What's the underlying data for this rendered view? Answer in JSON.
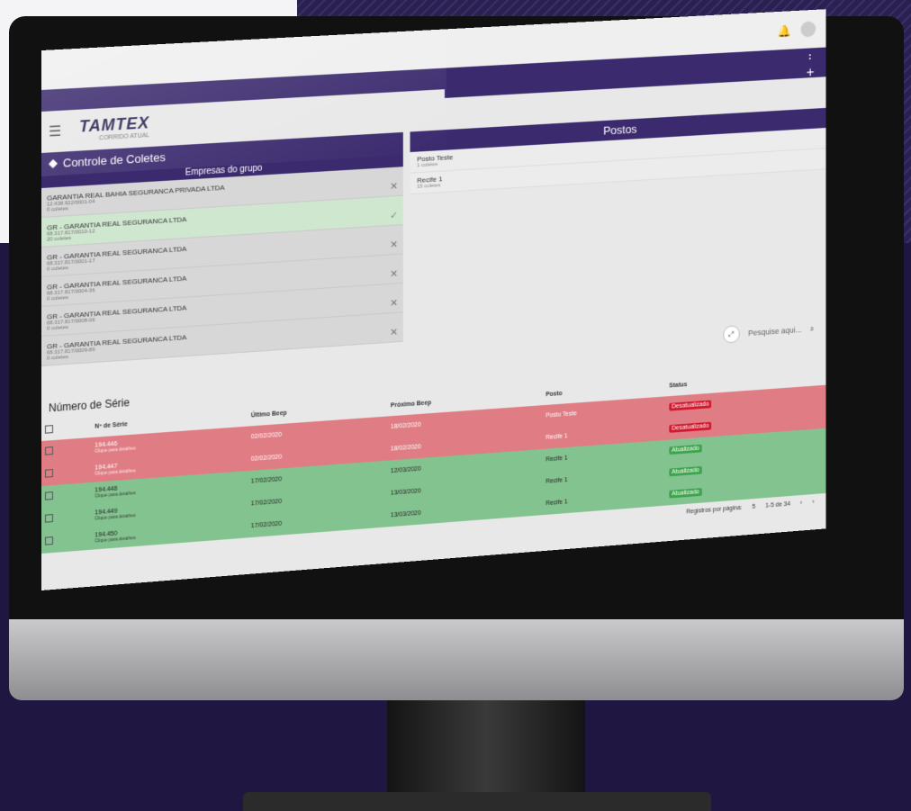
{
  "logo": {
    "name": "TAMTEX",
    "tag": "CORRIDO ATUAL"
  },
  "top_icons": {
    "bell": "bell-icon"
  },
  "header": {
    "title": "Controle de Coletes",
    "postos_title": "Postos"
  },
  "empresas": {
    "title": "Empresas do grupo",
    "items": [
      {
        "name": "GARANTIA REAL BAHIA SEGURANCA PRIVADA LTDA",
        "cnpj": "12.438.922/0001-04",
        "count": "0 coletes",
        "selected": false
      },
      {
        "name": "GR - GARANTIA REAL SEGURANCA LTDA",
        "cnpj": "68.317.817/0010-12",
        "count": "20 coletes",
        "selected": true
      },
      {
        "name": "GR - GARANTIA REAL SEGURANCA LTDA",
        "cnpj": "68.317.817/0001-17",
        "count": "0 coletes",
        "selected": false
      },
      {
        "name": "GR - GARANTIA REAL SEGURANCA LTDA",
        "cnpj": "68.317.817/0004-36",
        "count": "0 coletes",
        "selected": false
      },
      {
        "name": "GR - GARANTIA REAL SEGURANCA LTDA",
        "cnpj": "68.317.817/0008-06",
        "count": "0 coletes",
        "selected": false
      },
      {
        "name": "GR - GARANTIA REAL SEGURANCA LTDA",
        "cnpj": "68.317.817/0009-89",
        "count": "0 coletes",
        "selected": false
      }
    ]
  },
  "postos": [
    {
      "name": "Posto Teste",
      "count": "1 coletes"
    },
    {
      "name": "Recife 1",
      "count": "15 coletes"
    }
  ],
  "search": {
    "placeholder": "Pesquise aqui..."
  },
  "table": {
    "title": "Número de Série",
    "headers": {
      "serie": "Nº de Série",
      "ultimo": "Último Beep",
      "proximo": "Próximo Beep",
      "posto": "Posto",
      "status": "Status"
    },
    "rows": [
      {
        "serie": "194.446",
        "hint": "Clique para detalhes",
        "ultimo": "02/02/2020",
        "proximo": "18/02/2020",
        "posto": "Posto Teste",
        "status": "Desatualizado",
        "state": "red"
      },
      {
        "serie": "194.447",
        "hint": "Clique para detalhes",
        "ultimo": "02/02/2020",
        "proximo": "18/02/2020",
        "posto": "Recife 1",
        "status": "Desatualizado",
        "state": "red"
      },
      {
        "serie": "194.448",
        "hint": "Clique para detalhes",
        "ultimo": "17/02/2020",
        "proximo": "12/03/2020",
        "posto": "Recife 1",
        "status": "Atualizado",
        "state": "green"
      },
      {
        "serie": "194.449",
        "hint": "Clique para detalhes",
        "ultimo": "17/02/2020",
        "proximo": "13/03/2020",
        "posto": "Recife 1",
        "status": "Atualizado",
        "state": "green"
      },
      {
        "serie": "194.450",
        "hint": "Clique para detalhes",
        "ultimo": "17/02/2020",
        "proximo": "13/03/2020",
        "posto": "Recife 1",
        "status": "Atualizado",
        "state": "green"
      }
    ]
  },
  "pagination": {
    "label": "Registros por página:",
    "size": "5",
    "range": "1-5 de 34"
  }
}
